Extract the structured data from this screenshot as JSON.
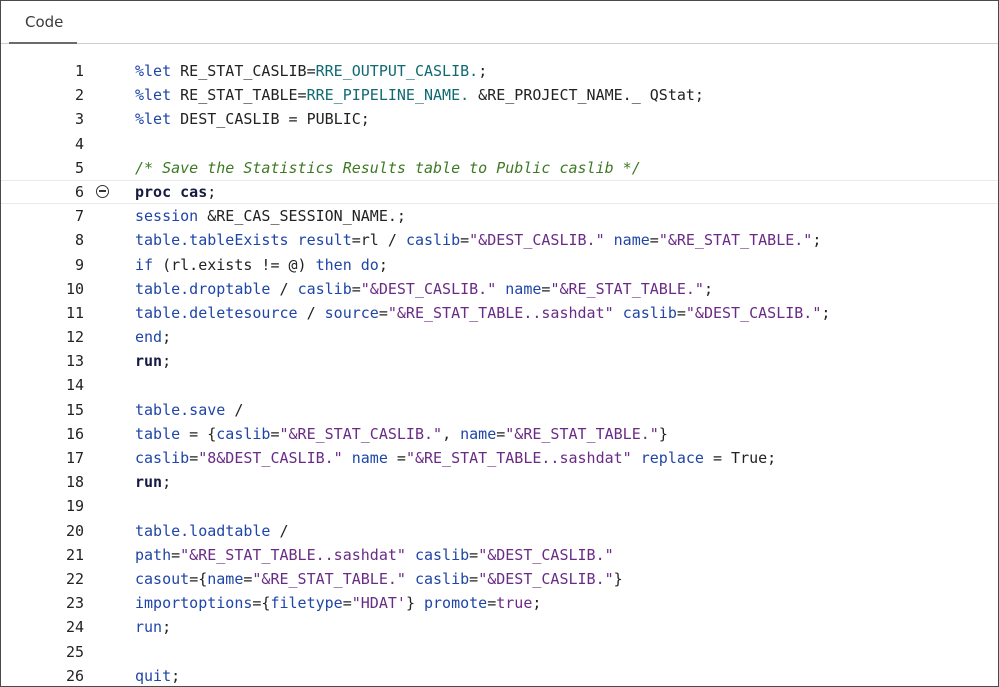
{
  "tab": {
    "label": "Code"
  },
  "colors": {
    "macro": "#1f45a8",
    "macro_name": "#0f6a72",
    "string": "#6a2b86",
    "comment": "#3d7a23",
    "text": "#222222",
    "keyword_bold": "#141a40"
  },
  "fold_icon": "collapse-minus-circle",
  "lines": [
    {
      "n": "1",
      "tokens": [
        {
          "t": "%let",
          "c": "tk-blue"
        },
        {
          "t": " RE_STAT_CASLIB=",
          "c": "tk-dark"
        },
        {
          "t": "RRE_OUTPUT_CASLIB.",
          "c": "tk-teal"
        },
        {
          "t": ";",
          "c": "tk-dark"
        }
      ]
    },
    {
      "n": "2",
      "tokens": [
        {
          "t": "%let",
          "c": "tk-blue"
        },
        {
          "t": " RE_STAT_TABLE=",
          "c": "tk-dark"
        },
        {
          "t": "RRE_PIPELINE_NAME.",
          "c": "tk-teal"
        },
        {
          "t": " &RE_PROJECT_NAME._ QStat;",
          "c": "tk-dark"
        }
      ]
    },
    {
      "n": "3",
      "tokens": [
        {
          "t": "%let",
          "c": "tk-blue"
        },
        {
          "t": " DEST_CASLIB = PUBLIC;",
          "c": "tk-dark"
        }
      ]
    },
    {
      "n": "4",
      "tokens": []
    },
    {
      "n": "5",
      "tokens": [
        {
          "t": "/* Save the Statistics Results table to Public caslib */",
          "c": "tk-green"
        }
      ]
    },
    {
      "n": "6",
      "fold": true,
      "tokens": [
        {
          "t": "proc cas",
          "c": "tk-bold"
        },
        {
          "t": ";",
          "c": "tk-dark"
        }
      ]
    },
    {
      "n": "7",
      "tokens": [
        {
          "t": "session",
          "c": "tk-blue"
        },
        {
          "t": " &RE_CAS_SESSION_NAME.;",
          "c": "tk-dark"
        }
      ]
    },
    {
      "n": "8",
      "tokens": [
        {
          "t": "table.tableExists",
          "c": "tk-blue"
        },
        {
          "t": " ",
          "c": "tk-dark"
        },
        {
          "t": "result",
          "c": "tk-blue"
        },
        {
          "t": "=rl / ",
          "c": "tk-dark"
        },
        {
          "t": "caslib",
          "c": "tk-blue"
        },
        {
          "t": "=",
          "c": "tk-dark"
        },
        {
          "t": "\"&DEST_CASLIB.\"",
          "c": "tk-purple"
        },
        {
          "t": " ",
          "c": "tk-dark"
        },
        {
          "t": "name",
          "c": "tk-blue"
        },
        {
          "t": "=",
          "c": "tk-dark"
        },
        {
          "t": "\"&RE_STAT_TABLE.\"",
          "c": "tk-purple"
        },
        {
          "t": ";",
          "c": "tk-dark"
        }
      ]
    },
    {
      "n": "9",
      "tokens": [
        {
          "t": "if",
          "c": "tk-blue"
        },
        {
          "t": " (rl.exists != @) ",
          "c": "tk-dark"
        },
        {
          "t": "then do",
          "c": "tk-blue"
        },
        {
          "t": ";",
          "c": "tk-dark"
        }
      ]
    },
    {
      "n": "10",
      "tokens": [
        {
          "t": "table.droptable",
          "c": "tk-blue"
        },
        {
          "t": " / ",
          "c": "tk-dark"
        },
        {
          "t": "caslib",
          "c": "tk-blue"
        },
        {
          "t": "=",
          "c": "tk-dark"
        },
        {
          "t": "\"&DEST_CASLIB.\"",
          "c": "tk-purple"
        },
        {
          "t": " ",
          "c": "tk-dark"
        },
        {
          "t": "name",
          "c": "tk-blue"
        },
        {
          "t": "=",
          "c": "tk-dark"
        },
        {
          "t": "\"&RE_STAT_TABLE.\"",
          "c": "tk-purple"
        },
        {
          "t": ";",
          "c": "tk-dark"
        }
      ]
    },
    {
      "n": "11",
      "tokens": [
        {
          "t": "table.deletesource",
          "c": "tk-blue"
        },
        {
          "t": " / ",
          "c": "tk-dark"
        },
        {
          "t": "source",
          "c": "tk-blue"
        },
        {
          "t": "=",
          "c": "tk-dark"
        },
        {
          "t": "\"&RE_STAT_TABLE..sashdat\"",
          "c": "tk-purple"
        },
        {
          "t": " ",
          "c": "tk-dark"
        },
        {
          "t": "caslib",
          "c": "tk-blue"
        },
        {
          "t": "=",
          "c": "tk-dark"
        },
        {
          "t": "\"&DEST_CASLIB.\"",
          "c": "tk-purple"
        },
        {
          "t": ";",
          "c": "tk-dark"
        }
      ]
    },
    {
      "n": "12",
      "tokens": [
        {
          "t": "end",
          "c": "tk-blue"
        },
        {
          "t": ";",
          "c": "tk-dark"
        }
      ]
    },
    {
      "n": "13",
      "tokens": [
        {
          "t": "run",
          "c": "tk-bold"
        },
        {
          "t": ";",
          "c": "tk-dark"
        }
      ]
    },
    {
      "n": "14",
      "tokens": []
    },
    {
      "n": "15",
      "tokens": [
        {
          "t": "table.save",
          "c": "tk-blue"
        },
        {
          "t": " /",
          "c": "tk-dark"
        }
      ]
    },
    {
      "n": "16",
      "tokens": [
        {
          "t": "table",
          "c": "tk-blue"
        },
        {
          "t": " = {",
          "c": "tk-dark"
        },
        {
          "t": "caslib",
          "c": "tk-blue"
        },
        {
          "t": "=",
          "c": "tk-dark"
        },
        {
          "t": "\"&RE_STAT_CASLIB.\"",
          "c": "tk-purple"
        },
        {
          "t": ", ",
          "c": "tk-dark"
        },
        {
          "t": "name",
          "c": "tk-blue"
        },
        {
          "t": "=",
          "c": "tk-dark"
        },
        {
          "t": "\"&RE_STAT_TABLE.\"",
          "c": "tk-purple"
        },
        {
          "t": "}",
          "c": "tk-dark"
        }
      ]
    },
    {
      "n": "17",
      "tokens": [
        {
          "t": "caslib",
          "c": "tk-blue"
        },
        {
          "t": "=",
          "c": "tk-dark"
        },
        {
          "t": "\"8&DEST_CASLIB.\"",
          "c": "tk-purple"
        },
        {
          "t": " ",
          "c": "tk-dark"
        },
        {
          "t": "name",
          "c": "tk-blue"
        },
        {
          "t": " =",
          "c": "tk-dark"
        },
        {
          "t": "\"&RE_STAT_TABLE..sashdat\"",
          "c": "tk-purple"
        },
        {
          "t": " ",
          "c": "tk-dark"
        },
        {
          "t": "replace",
          "c": "tk-blue"
        },
        {
          "t": " = True;",
          "c": "tk-dark"
        }
      ]
    },
    {
      "n": "18",
      "tokens": [
        {
          "t": "run",
          "c": "tk-bold"
        },
        {
          "t": ";",
          "c": "tk-dark"
        }
      ]
    },
    {
      "n": "19",
      "tokens": []
    },
    {
      "n": "20",
      "tokens": [
        {
          "t": "table.loadtable",
          "c": "tk-blue"
        },
        {
          "t": " /",
          "c": "tk-dark"
        }
      ]
    },
    {
      "n": "21",
      "tokens": [
        {
          "t": "path",
          "c": "tk-blue"
        },
        {
          "t": "=",
          "c": "tk-dark"
        },
        {
          "t": "\"&RE_STAT_TABLE..sashdat\"",
          "c": "tk-purple"
        },
        {
          "t": " ",
          "c": "tk-dark"
        },
        {
          "t": "caslib",
          "c": "tk-blue"
        },
        {
          "t": "=",
          "c": "tk-dark"
        },
        {
          "t": "\"&DEST_CASLIB.\"",
          "c": "tk-purple"
        }
      ]
    },
    {
      "n": "22",
      "tokens": [
        {
          "t": "casout",
          "c": "tk-blue"
        },
        {
          "t": "={",
          "c": "tk-dark"
        },
        {
          "t": "name",
          "c": "tk-blue"
        },
        {
          "t": "=",
          "c": "tk-dark"
        },
        {
          "t": "\"&RE_STAT_TABLE.\"",
          "c": "tk-purple"
        },
        {
          "t": " ",
          "c": "tk-dark"
        },
        {
          "t": "caslib",
          "c": "tk-blue"
        },
        {
          "t": "=",
          "c": "tk-dark"
        },
        {
          "t": "\"&DEST_CASLIB.\"",
          "c": "tk-purple"
        },
        {
          "t": "}",
          "c": "tk-dark"
        }
      ]
    },
    {
      "n": "23",
      "tokens": [
        {
          "t": "importoptions",
          "c": "tk-blue"
        },
        {
          "t": "={",
          "c": "tk-dark"
        },
        {
          "t": "filetype",
          "c": "tk-blue"
        },
        {
          "t": "=",
          "c": "tk-dark"
        },
        {
          "t": "\"HDAT'",
          "c": "tk-purple"
        },
        {
          "t": "} ",
          "c": "tk-dark"
        },
        {
          "t": "promote",
          "c": "tk-blue"
        },
        {
          "t": "=",
          "c": "tk-dark"
        },
        {
          "t": "true",
          "c": "tk-purple"
        },
        {
          "t": ";",
          "c": "tk-dark"
        }
      ]
    },
    {
      "n": "24",
      "tokens": [
        {
          "t": "run",
          "c": "tk-blue"
        },
        {
          "t": ";",
          "c": "tk-dark"
        }
      ]
    },
    {
      "n": "25",
      "tokens": []
    },
    {
      "n": "26",
      "tokens": [
        {
          "t": "quit",
          "c": "tk-blue"
        },
        {
          "t": ";",
          "c": "tk-dark"
        }
      ]
    }
  ]
}
